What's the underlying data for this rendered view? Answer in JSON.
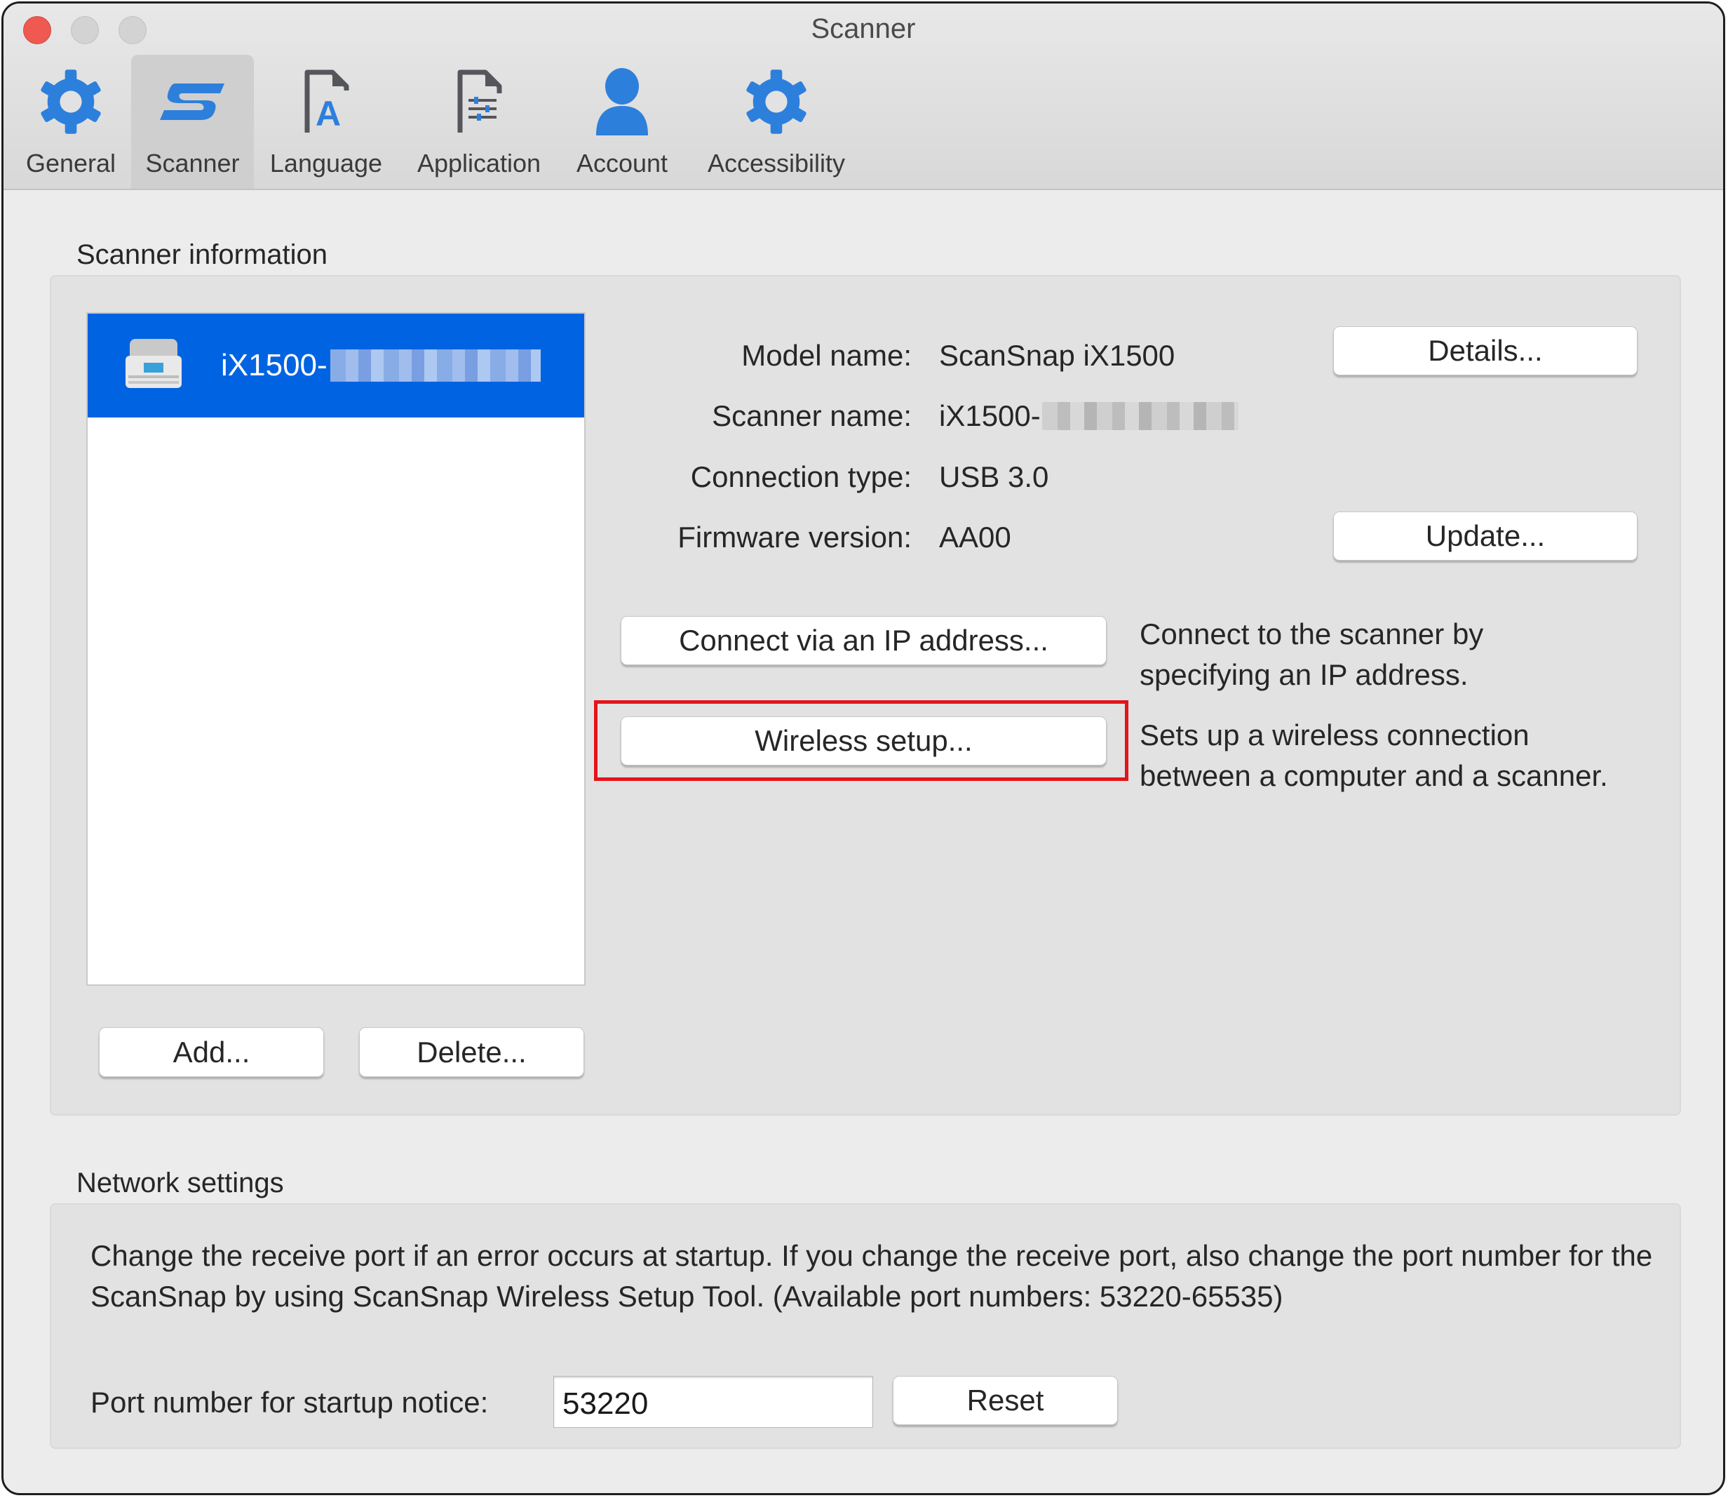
{
  "window": {
    "title": "Scanner"
  },
  "toolbar": {
    "tabs": [
      {
        "label": "General",
        "icon": "gear-icon",
        "active": false
      },
      {
        "label": "Scanner",
        "icon": "scansnap-logo-icon",
        "active": true
      },
      {
        "label": "Language",
        "icon": "language-document-icon",
        "active": false
      },
      {
        "label": "Application",
        "icon": "application-document-icon",
        "active": false
      },
      {
        "label": "Account",
        "icon": "person-icon",
        "active": false
      },
      {
        "label": "Accessibility",
        "icon": "gear-icon",
        "active": false
      }
    ]
  },
  "scanner_info": {
    "section_label": "Scanner information",
    "list": {
      "items": [
        {
          "name_prefix": "iX1500-",
          "name_redacted": true,
          "selected": true,
          "icon": "scanner-icon"
        }
      ]
    },
    "fields": [
      {
        "label": "Model name:",
        "value": "ScanSnap iX1500"
      },
      {
        "label": "Scanner name:",
        "value": "iX1500-",
        "redacted": true
      },
      {
        "label": "Connection type:",
        "value": "USB 3.0"
      },
      {
        "label": "Firmware version:",
        "value": "AA00"
      }
    ],
    "details_button": "Details...",
    "update_button": "Update...",
    "connect_ip_button": "Connect via an IP address...",
    "connect_ip_desc": [
      "Connect to the scanner by",
      "specifying an IP address."
    ],
    "wireless_button": "Wireless setup...",
    "wireless_desc": [
      "Sets up a wireless connection",
      "between a computer and a scanner."
    ],
    "add_button": "Add...",
    "delete_button": "Delete..."
  },
  "network": {
    "section_label": "Network settings",
    "description": "Change the receive port if an error occurs at startup. If you change the receive port, also change the port number for the ScanSnap by using ScanSnap Wireless Setup Tool. (Available port numbers: 53220-65535)",
    "port_label": "Port number for startup notice:",
    "port_value": "53220",
    "reset_button": "Reset"
  },
  "colors": {
    "accent_blue": "#0063e1",
    "icon_blue": "#2d7fdc",
    "highlight_red": "#e3141b",
    "close_red": "#ee5a52"
  }
}
